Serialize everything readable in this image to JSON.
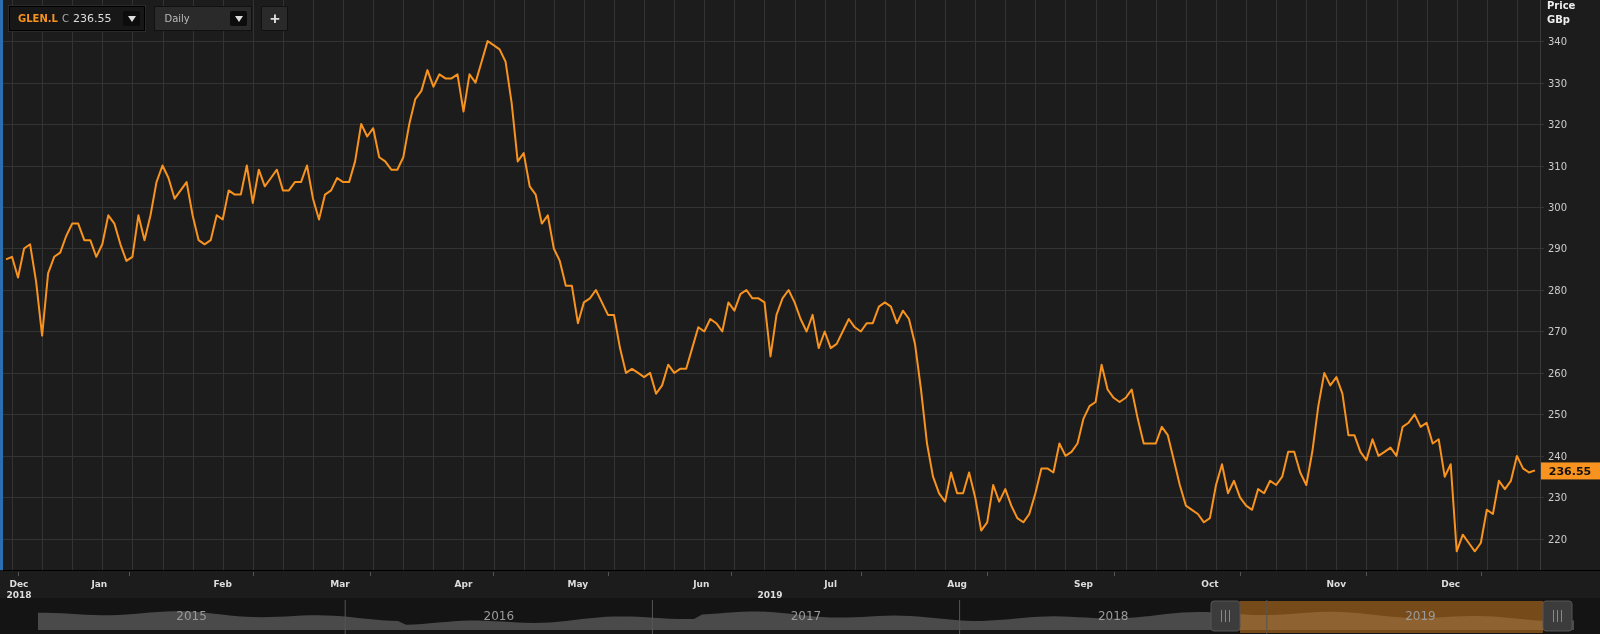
{
  "toolbar": {
    "symbol": {
      "close_label": "C",
      "close_value": "236.55"
    },
    "interval": {
      "value": "Daily"
    },
    "add_button": {
      "label": "+"
    }
  },
  "chart": {
    "month_labels": [
      "Dec",
      "Jan",
      "Feb",
      "Mar",
      "Apr",
      "May",
      "Jun",
      "Jul",
      "Aug",
      "Sep",
      "Oct",
      "Nov",
      "Dec"
    ],
    "chart_data": {
      "type": "line",
      "ylabel": "Price GBp",
      "ylim": [
        212.5,
        349.9
      ],
      "yticks": [
        220,
        230,
        240,
        250,
        260,
        270,
        280,
        290,
        300,
        310,
        320,
        330,
        340
      ],
      "grid": true,
      "series": [
        {
          "name": "GLEN.L",
          "color": "#f7931e",
          "values": [
            287.4,
            288,
            283,
            290,
            291,
            282,
            269,
            284,
            288,
            289,
            293,
            296,
            296,
            292,
            292,
            288,
            291,
            298,
            296,
            291,
            287,
            288,
            298,
            292,
            298,
            306,
            310,
            307,
            302,
            304,
            306,
            298,
            292,
            291,
            292,
            298,
            297,
            304,
            303,
            303,
            310,
            301,
            309,
            305,
            307,
            309,
            304,
            304,
            306,
            306,
            310,
            302,
            297,
            303,
            304,
            307,
            306,
            306,
            311,
            320,
            317,
            319,
            312,
            311,
            309,
            309,
            312,
            320,
            326,
            328,
            333,
            329,
            332,
            331,
            331,
            332,
            323,
            332,
            330,
            335,
            340,
            339,
            338,
            335,
            325,
            311,
            313,
            305,
            303,
            296,
            298,
            290,
            287,
            281,
            281,
            272,
            277,
            278,
            280,
            277,
            274,
            274,
            266,
            260,
            261,
            260,
            259,
            260,
            255,
            257,
            262,
            260,
            261,
            261,
            266,
            271,
            270,
            273,
            272,
            270,
            277,
            275,
            279,
            280,
            278,
            278,
            277,
            264,
            274,
            278,
            280,
            277,
            273,
            270,
            274,
            266,
            270,
            266,
            267,
            270,
            273,
            271,
            270,
            272,
            272,
            276,
            277,
            276,
            272,
            275,
            273,
            267,
            256,
            243,
            235,
            231,
            229,
            236,
            231,
            231,
            236,
            230,
            222,
            224,
            233,
            229,
            232,
            228,
            225,
            224,
            226,
            231,
            237,
            237,
            236,
            243,
            240,
            241,
            243,
            249,
            252,
            253,
            262,
            256,
            254,
            253,
            254,
            256,
            249,
            243,
            243,
            243,
            247,
            245,
            239,
            233,
            228,
            227,
            226,
            224,
            225,
            233,
            238,
            231,
            234,
            230,
            228,
            227,
            232,
            231,
            234,
            233,
            235,
            241,
            241,
            236,
            233,
            241,
            252,
            260,
            257,
            259,
            255,
            245,
            245,
            241,
            239,
            244,
            240,
            241,
            242,
            240,
            247,
            248,
            250,
            247,
            248,
            243,
            244,
            235,
            238,
            217,
            221,
            219,
            217,
            219,
            227,
            226,
            234,
            232,
            234,
            240,
            237,
            236,
            236.5
          ]
        }
      ]
    },
    "year_labels": [
      "2018",
      "2019"
    ],
    "last_price": "236.55"
  },
  "navigator": {
    "years": [
      "2015",
      "2016",
      "2017",
      "2018",
      "2019"
    ]
  }
}
